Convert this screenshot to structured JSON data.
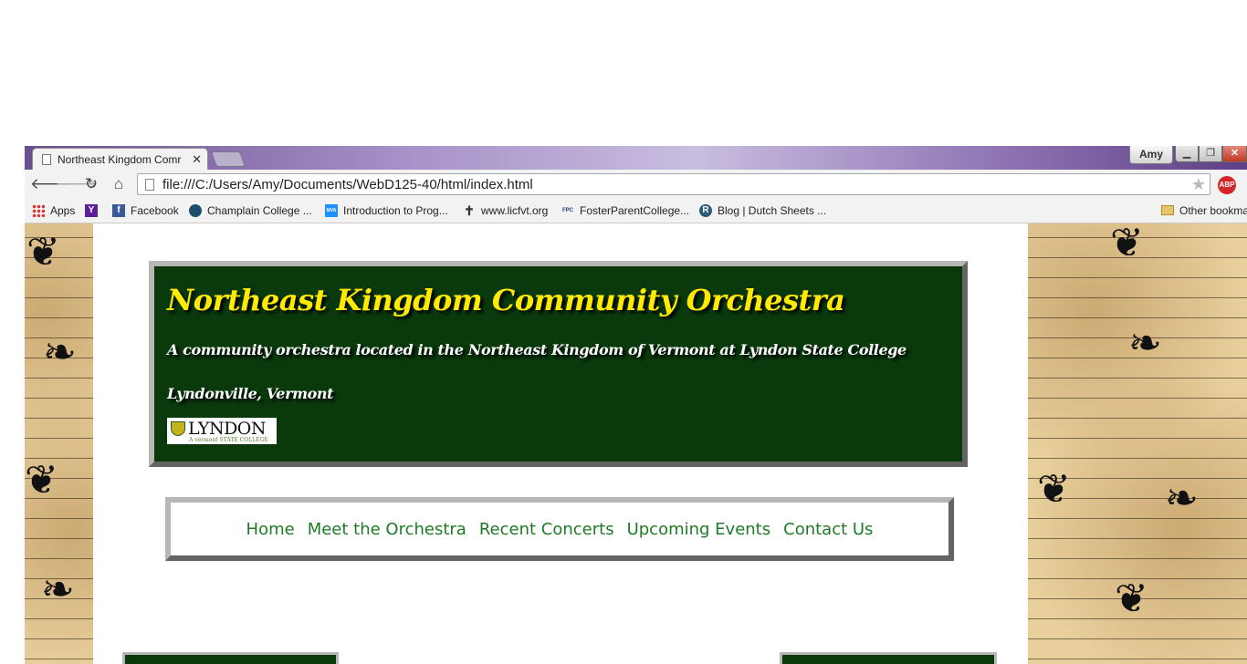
{
  "browser": {
    "tab_title": "Northeast Kingdom Comr",
    "user_name": "Amy",
    "url": "file:///C:/Users/Amy/Documents/WebD125-40/html/index.html",
    "abp_label": "ABP",
    "bookmarks": [
      {
        "label": "Apps",
        "icon": "apps-grid-icon"
      },
      {
        "label": "",
        "icon": "yahoo-icon",
        "glyph": "Y"
      },
      {
        "label": "Facebook",
        "icon": "facebook-icon",
        "glyph": "f"
      },
      {
        "label": "Champlain College ...",
        "icon": "champlain-icon"
      },
      {
        "label": "Introduction to Prog...",
        "icon": "mva-icon",
        "glyph": "MVA"
      },
      {
        "label": "www.licfvt.org",
        "icon": "cross-icon",
        "glyph": "✝"
      },
      {
        "label": "FosterParentCollege...",
        "icon": "fpc-icon",
        "glyph": "FPC"
      },
      {
        "label": "Blog | Dutch Sheets ...",
        "icon": "blog-icon",
        "glyph": "R"
      }
    ],
    "other_bookmarks": "Other bookmarks"
  },
  "site": {
    "title": "Northeast Kingdom Community Orchestra",
    "tagline": "A community orchestra located in the Northeast Kingdom of Vermont at Lyndon State College",
    "location": "Lyndonville, Vermont",
    "logo_word": "LYNDON",
    "logo_sub": "A vermont STATE COLLEGE",
    "nav": [
      "Home",
      "Meet the Orchestra",
      "Recent Concerts",
      "Upcoming Events",
      "Contact Us"
    ]
  },
  "colors": {
    "header_green": "#0a3a0c",
    "title_yellow": "#ffea00",
    "nav_link_green": "#1f7a27",
    "border_gray": "#b7b7b7"
  }
}
